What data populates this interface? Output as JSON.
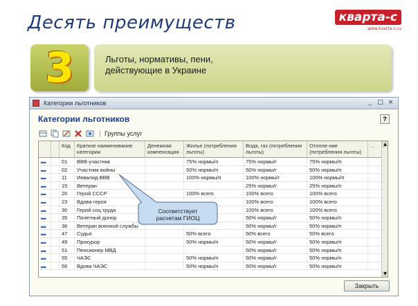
{
  "slide": {
    "title": "Десять преимуществ",
    "logo_main": "кварта-с",
    "logo_sub": "www.kvarta-c.ru",
    "number": "3",
    "description_line1": "Льготы, нормативы, пени,",
    "description_line2": "действующие в Украине"
  },
  "window": {
    "title": "Категории льготников",
    "form_title": "Категории льготников",
    "help": "?",
    "controls": [
      "_",
      "□",
      "×"
    ],
    "toolbar": {
      "groups_button": "Группы услуг"
    },
    "close_button": "Закрыть"
  },
  "grid": {
    "headers": [
      "",
      "",
      "Код",
      "Краткое наименование категории",
      "Денежная компенсация",
      "Жилье (потребления льготы)",
      "Вода, газ (потребления льготы)",
      "Отопле-ние (потребления льготы)",
      "..."
    ],
    "rows": [
      {
        "mark": "▬",
        "code": "01",
        "name": "ВВВ-участник",
        "comp": "",
        "housing": "75% нормы/п",
        "water": "75% нормы/г",
        "heat": "75% нормы/п"
      },
      {
        "mark": "▬",
        "code": "02",
        "name": "Участник войны",
        "comp": "",
        "housing": "50% нормы/п",
        "water": "50% нормы/г",
        "heat": "50% нормы/п"
      },
      {
        "mark": "▬",
        "code": "11",
        "name": "Инвалид ВВВ",
        "comp": "",
        "housing": "100% нормы/п",
        "water": "100% нормы/г",
        "heat": "100% нормы/п"
      },
      {
        "mark": "▬",
        "code": "15",
        "name": "Ветеран",
        "comp": "",
        "housing": "",
        "water": "25% нормы/г",
        "heat": "25% нормы/п"
      },
      {
        "mark": "▬",
        "code": "20",
        "name": "Герой СССР",
        "comp": "",
        "housing": "100% всего",
        "water": "100% всего",
        "heat": "100% всего"
      },
      {
        "mark": "▬",
        "code": "23",
        "name": "Вдова героя",
        "comp": "",
        "housing": "",
        "water": "100% всего",
        "heat": "100% всего"
      },
      {
        "mark": "▬",
        "code": "30",
        "name": "Герой соц.труда",
        "comp": "",
        "housing": "",
        "water": "100% всего",
        "heat": "100% всего"
      },
      {
        "mark": "▬",
        "code": "35",
        "name": "Почетный донор",
        "comp": "",
        "housing": "",
        "water": "50% нормы/г",
        "heat": "50% нормы/п"
      },
      {
        "mark": "▬",
        "code": "36",
        "name": "Ветеран военной службы",
        "comp": "",
        "housing": "",
        "water": "50% нормы/г",
        "heat": "50% нормы/п"
      },
      {
        "mark": "▬",
        "code": "47",
        "name": "Судья",
        "comp": "",
        "housing": "50% всего",
        "water": "50% всего",
        "heat": "50% всего"
      },
      {
        "mark": "▬",
        "code": "49",
        "name": "Прокурор",
        "comp": "",
        "housing": "50% нормы/п",
        "water": "50% нормы/г",
        "heat": "50% нормы/п"
      },
      {
        "mark": "▬",
        "code": "51",
        "name": "Пенсионер МВД",
        "comp": "",
        "housing": "",
        "water": "50% нормы/г",
        "heat": "50% нормы/п"
      },
      {
        "mark": "▬",
        "code": "55",
        "name": "ЧАЭС",
        "comp": "",
        "housing": "50% нормы/п",
        "water": "50% нормы/г",
        "heat": "50% нормы/п"
      },
      {
        "mark": "▬",
        "code": "56",
        "name": "Вдова ЧАЭС",
        "comp": "",
        "housing": "50% нормы/п",
        "water": "50% нормы/г",
        "heat": "50% нормы/п"
      }
    ]
  },
  "callout": {
    "text_line1": "Соответствует",
    "text_line2": "расчетам ГИОЦ"
  }
}
